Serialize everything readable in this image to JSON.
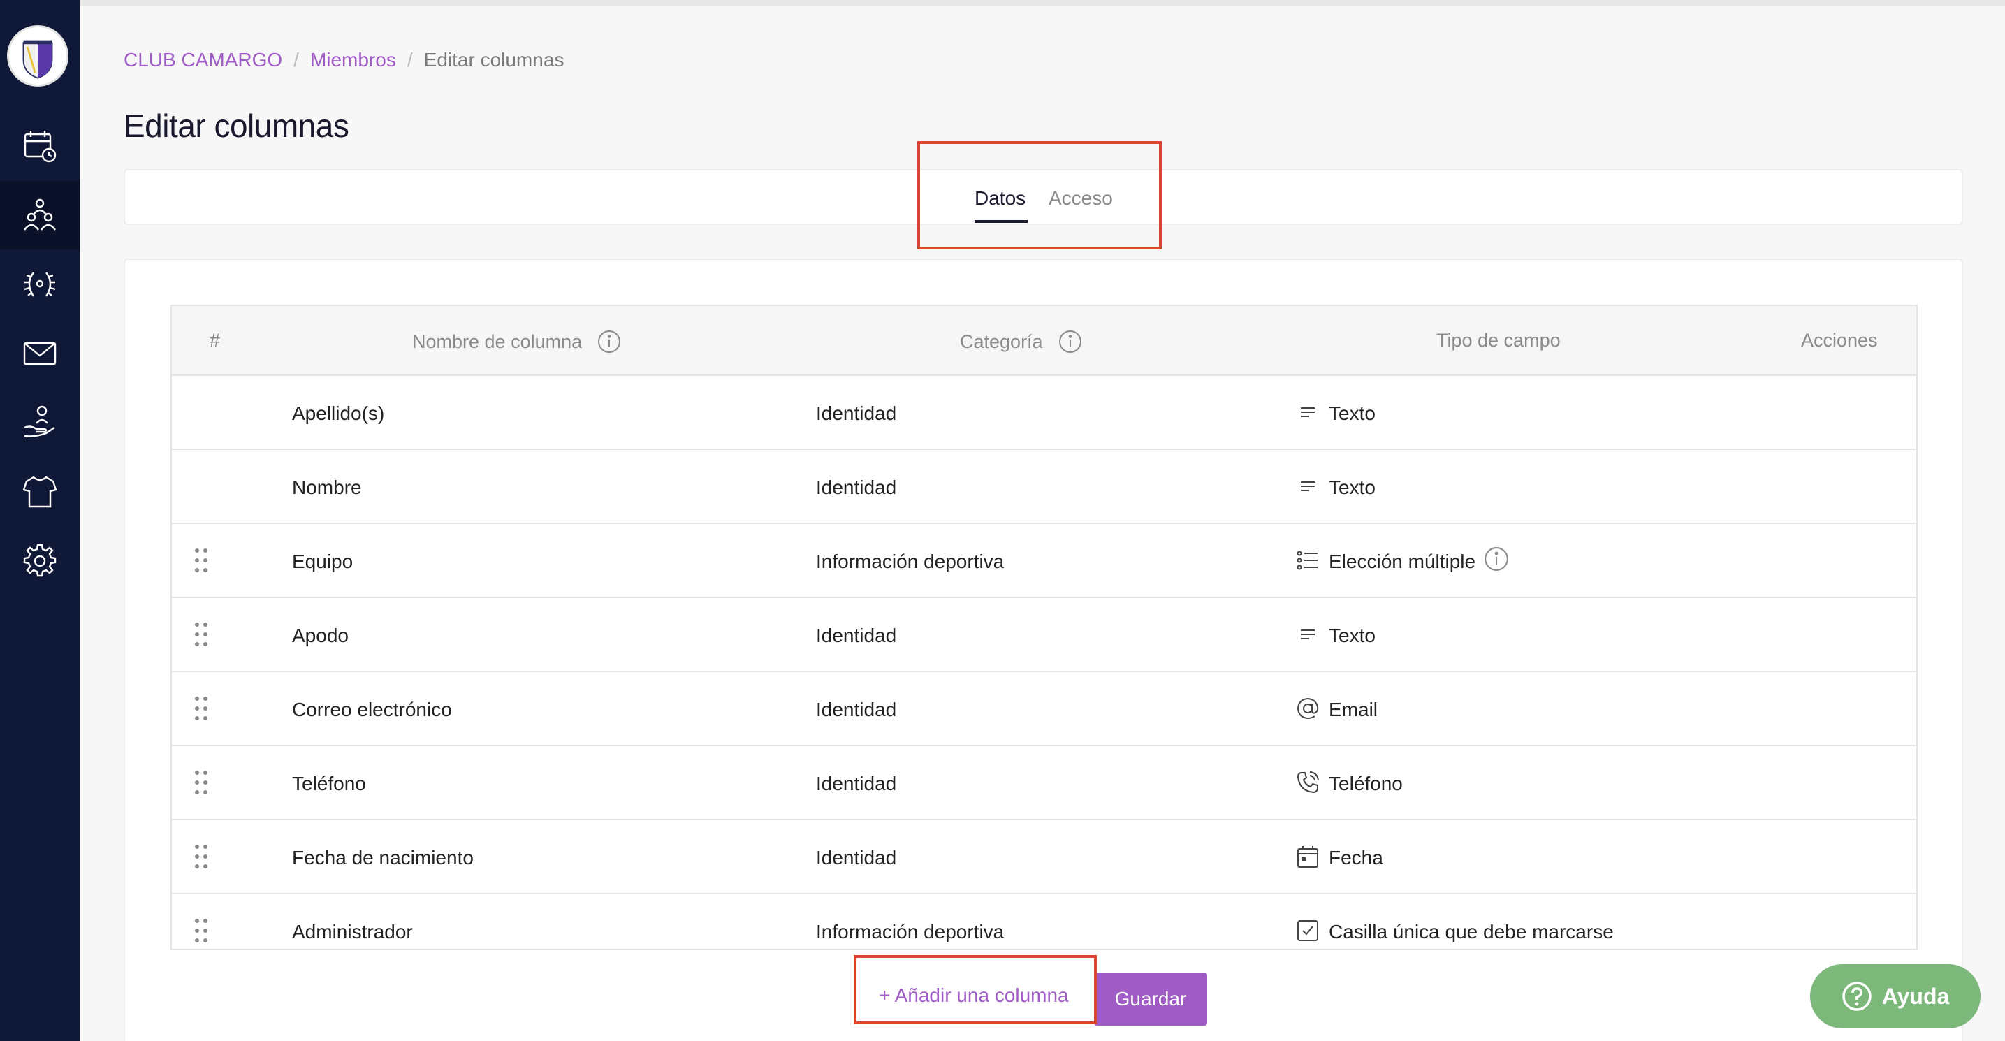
{
  "breadcrumb": {
    "club": "CLUB CAMARGO",
    "members": "Miembros",
    "current": "Editar columnas"
  },
  "page_title": "Editar columnas",
  "tabs": [
    {
      "label": "Datos",
      "active": true
    },
    {
      "label": "Acceso",
      "active": false
    }
  ],
  "table": {
    "headers": {
      "index": "#",
      "name": "Nombre de columna",
      "category": "Categoría",
      "type": "Tipo de campo",
      "actions": "Acciones"
    },
    "rows": [
      {
        "name": "Apellido(s)",
        "category": "Identidad",
        "type": "Texto",
        "icon": "text-lines-icon",
        "draggable": false
      },
      {
        "name": "Nombre",
        "category": "Identidad",
        "type": "Texto",
        "icon": "text-lines-icon",
        "draggable": false
      },
      {
        "name": "Equipo",
        "category": "Información deportiva",
        "type": "Elección múltiple",
        "icon": "list-icon",
        "draggable": true
      },
      {
        "name": "Apodo",
        "category": "Identidad",
        "type": "Texto",
        "icon": "text-lines-icon",
        "draggable": true
      },
      {
        "name": "Correo electrónico",
        "category": "Identidad",
        "type": "Email",
        "icon": "at-icon",
        "draggable": true
      },
      {
        "name": "Teléfono",
        "category": "Identidad",
        "type": "Teléfono",
        "icon": "phone-icon",
        "draggable": true
      },
      {
        "name": "Fecha de nacimiento",
        "category": "Identidad",
        "type": "Fecha",
        "icon": "calendar-icon",
        "draggable": true
      },
      {
        "name": "Administrador",
        "category": "Información deportiva",
        "type": "Casilla única que debe marcarse",
        "icon": "checkbox-icon",
        "draggable": true
      }
    ]
  },
  "actions": {
    "add_column": "+ Añadir una columna",
    "save": "Guardar"
  },
  "help": {
    "label": "Ayuda"
  },
  "colors": {
    "sidebar": "#0f1836",
    "accent": "#a05cc5",
    "highlight": "#d9452f",
    "help": "#7bb87a"
  }
}
